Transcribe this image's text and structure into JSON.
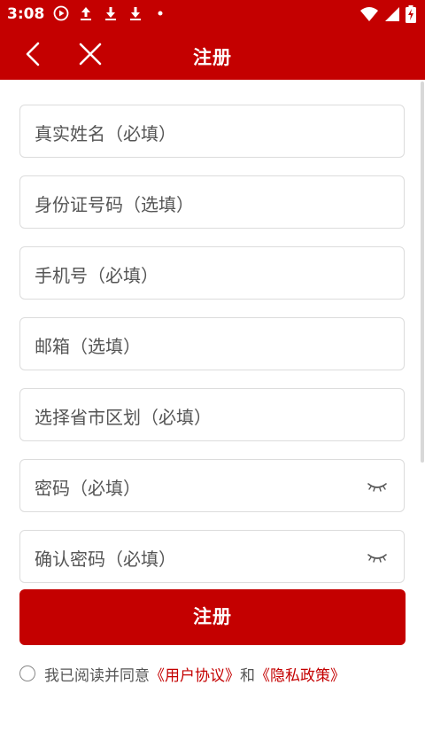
{
  "status_bar": {
    "time": "3:08",
    "icons": [
      "play-icon",
      "upload-icon",
      "download-icon",
      "download-icon",
      "dot-icon",
      "wifi-icon",
      "signal-icon",
      "battery-charging-icon"
    ]
  },
  "app_bar": {
    "title": "注册",
    "back_icon": "chevron-left-icon",
    "close_icon": "close-icon"
  },
  "form": {
    "real_name_placeholder": "真实姓名（必填）",
    "id_number_placeholder": "身份证号码（选填）",
    "phone_placeholder": "手机号（必填）",
    "email_placeholder": "邮箱（选填）",
    "region_placeholder": "选择省市区划（必填）",
    "password_placeholder": "密码（必填）",
    "confirm_password_placeholder": "确认密码（必填）",
    "eye_icon": "eye-closed-icon"
  },
  "submit_label": "注册",
  "agreement": {
    "prefix": "我已阅读并同意",
    "user_agreement": "《用户协议》",
    "and": "和",
    "privacy_policy": "《隐私政策》"
  },
  "colors": {
    "primary": "#c40000",
    "border": "#dcdcdc",
    "text": "#555555"
  }
}
